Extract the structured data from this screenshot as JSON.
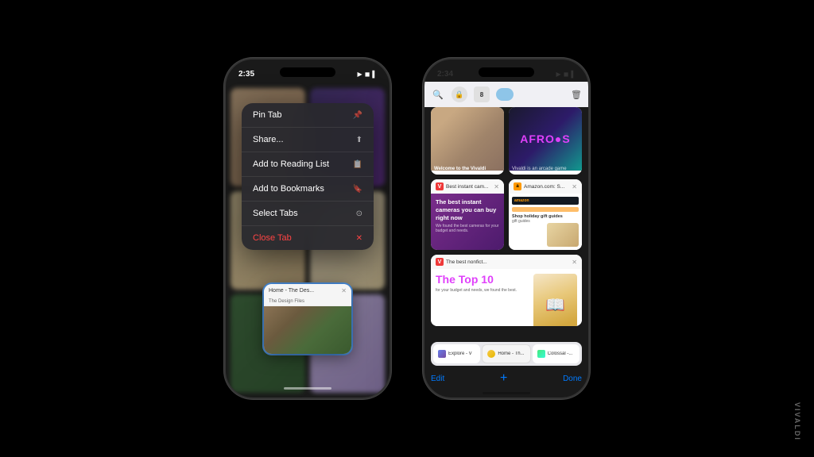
{
  "page": {
    "background": "#000000",
    "watermark": "VIVALDI"
  },
  "phone_left": {
    "status_time": "2:35",
    "status_icons": "▶ ◼ 🔋",
    "context_menu": {
      "items": [
        {
          "label": "Pin Tab",
          "icon": "📌",
          "danger": false
        },
        {
          "label": "Share...",
          "icon": "⬆",
          "danger": false
        },
        {
          "label": "Add to Reading List",
          "icon": "📋",
          "danger": false
        },
        {
          "label": "Add to Bookmarks",
          "icon": "🔖",
          "danger": false
        },
        {
          "label": "Select Tabs",
          "icon": "",
          "danger": false
        },
        {
          "label": "Close Tab",
          "icon": "✕",
          "danger": true
        }
      ]
    },
    "active_tab": {
      "title": "Home - The Des...",
      "subtitle": "The Design Files",
      "close_icon": "✕"
    }
  },
  "phone_right": {
    "status_time": "2:34",
    "status_icons": "▶ ◼ 🔋",
    "tabs": [
      {
        "id": "vivaldi",
        "title": "Welcome to the Vivaldi",
        "type": "vivaldi"
      },
      {
        "id": "afro",
        "title": "Vivaldi is an arcade game",
        "type": "afro"
      },
      {
        "id": "camera",
        "title": "Best instant cam...",
        "favicon_type": "vivaldi-v",
        "close": true
      },
      {
        "id": "amazon",
        "title": "Amazon.com: S...",
        "favicon_type": "amazon",
        "close": true
      },
      {
        "id": "top10",
        "title": "The best nonfict...",
        "favicon_type": "vivaldi-v",
        "close": true
      }
    ],
    "camera_tab": {
      "heading": "The best instant cameras you can buy right now",
      "subtext": "We found the best cameras for your budget and needs."
    },
    "amazon_tab": {
      "logo": "amazon",
      "promo": "Shop holiday gift guides"
    },
    "top10_tab": {
      "heading": "The best nonfict...",
      "title": "The Top 10",
      "description": "for your budget and needs, we found the best."
    },
    "tab_strip": [
      {
        "label": "Explore - V",
        "favicon_type": "explore"
      },
      {
        "label": "Home - Th...",
        "favicon_type": "home"
      },
      {
        "label": "Colossal -...",
        "favicon_type": "colossal"
      }
    ],
    "bottom_bar": {
      "edit": "Edit",
      "add": "+",
      "done": "Done"
    }
  }
}
